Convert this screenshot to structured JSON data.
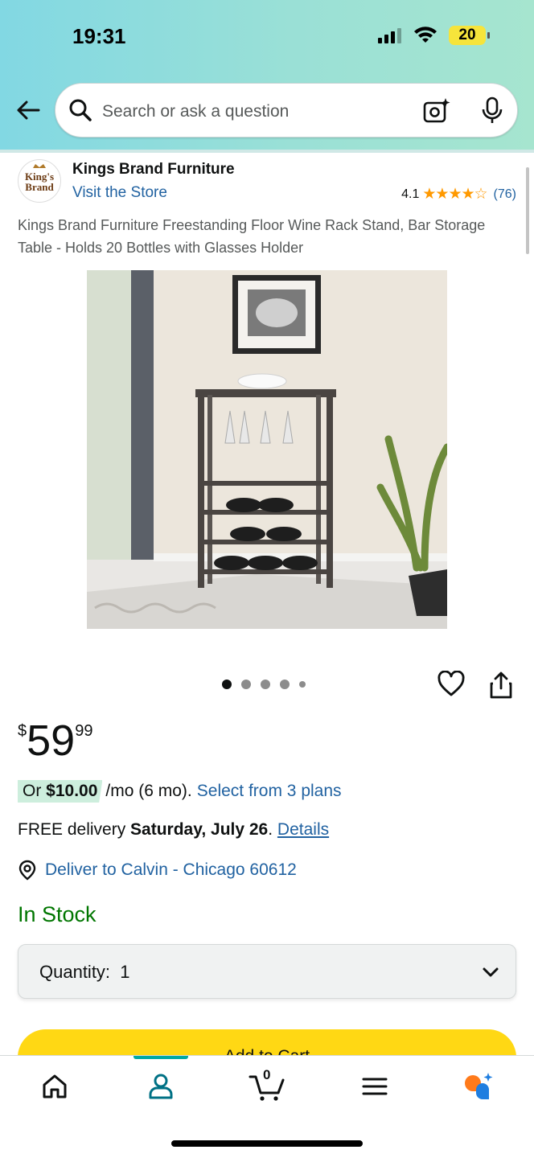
{
  "status_bar": {
    "time": "19:31",
    "battery": "20"
  },
  "search": {
    "placeholder": "Search or ask a question"
  },
  "brand": {
    "name": "Kings Brand Furniture",
    "visit_link": "Visit the Store",
    "logo_text_top": "King's",
    "logo_text_bottom": "Brand"
  },
  "rating": {
    "value": "4.1",
    "stars": "★★★★☆",
    "count": "(76)"
  },
  "product": {
    "title": "Kings Brand Furniture Freestanding Floor Wine Rack Stand, Bar Storage Table - Holds 20 Bottles with Glasses Holder",
    "image_count": 5,
    "active_image": 1
  },
  "price": {
    "symbol": "$",
    "whole": "59",
    "fraction": "99"
  },
  "installment": {
    "prefix": "Or ",
    "amount": "$10.00",
    "suffix": " /mo (6 mo).",
    "plans_link": "Select from 3 plans"
  },
  "delivery": {
    "prefix": "FREE delivery ",
    "date": "Saturday, July 26",
    "period": ". ",
    "details_link": "Details"
  },
  "deliver_to": {
    "text": "Deliver to Calvin - Chicago 60612"
  },
  "stock": {
    "status": "In Stock"
  },
  "quantity": {
    "label": "Quantity:",
    "value": "1"
  },
  "add_to_cart": {
    "label": "Add to Cart"
  },
  "bottom_nav": {
    "cart_count": "0",
    "active": "account"
  },
  "colors": {
    "link": "#2162a1",
    "stock_green": "#007600",
    "cart_yellow": "#ffd814",
    "star_orange": "#ff9900",
    "nav_accent": "#00a8a4"
  }
}
